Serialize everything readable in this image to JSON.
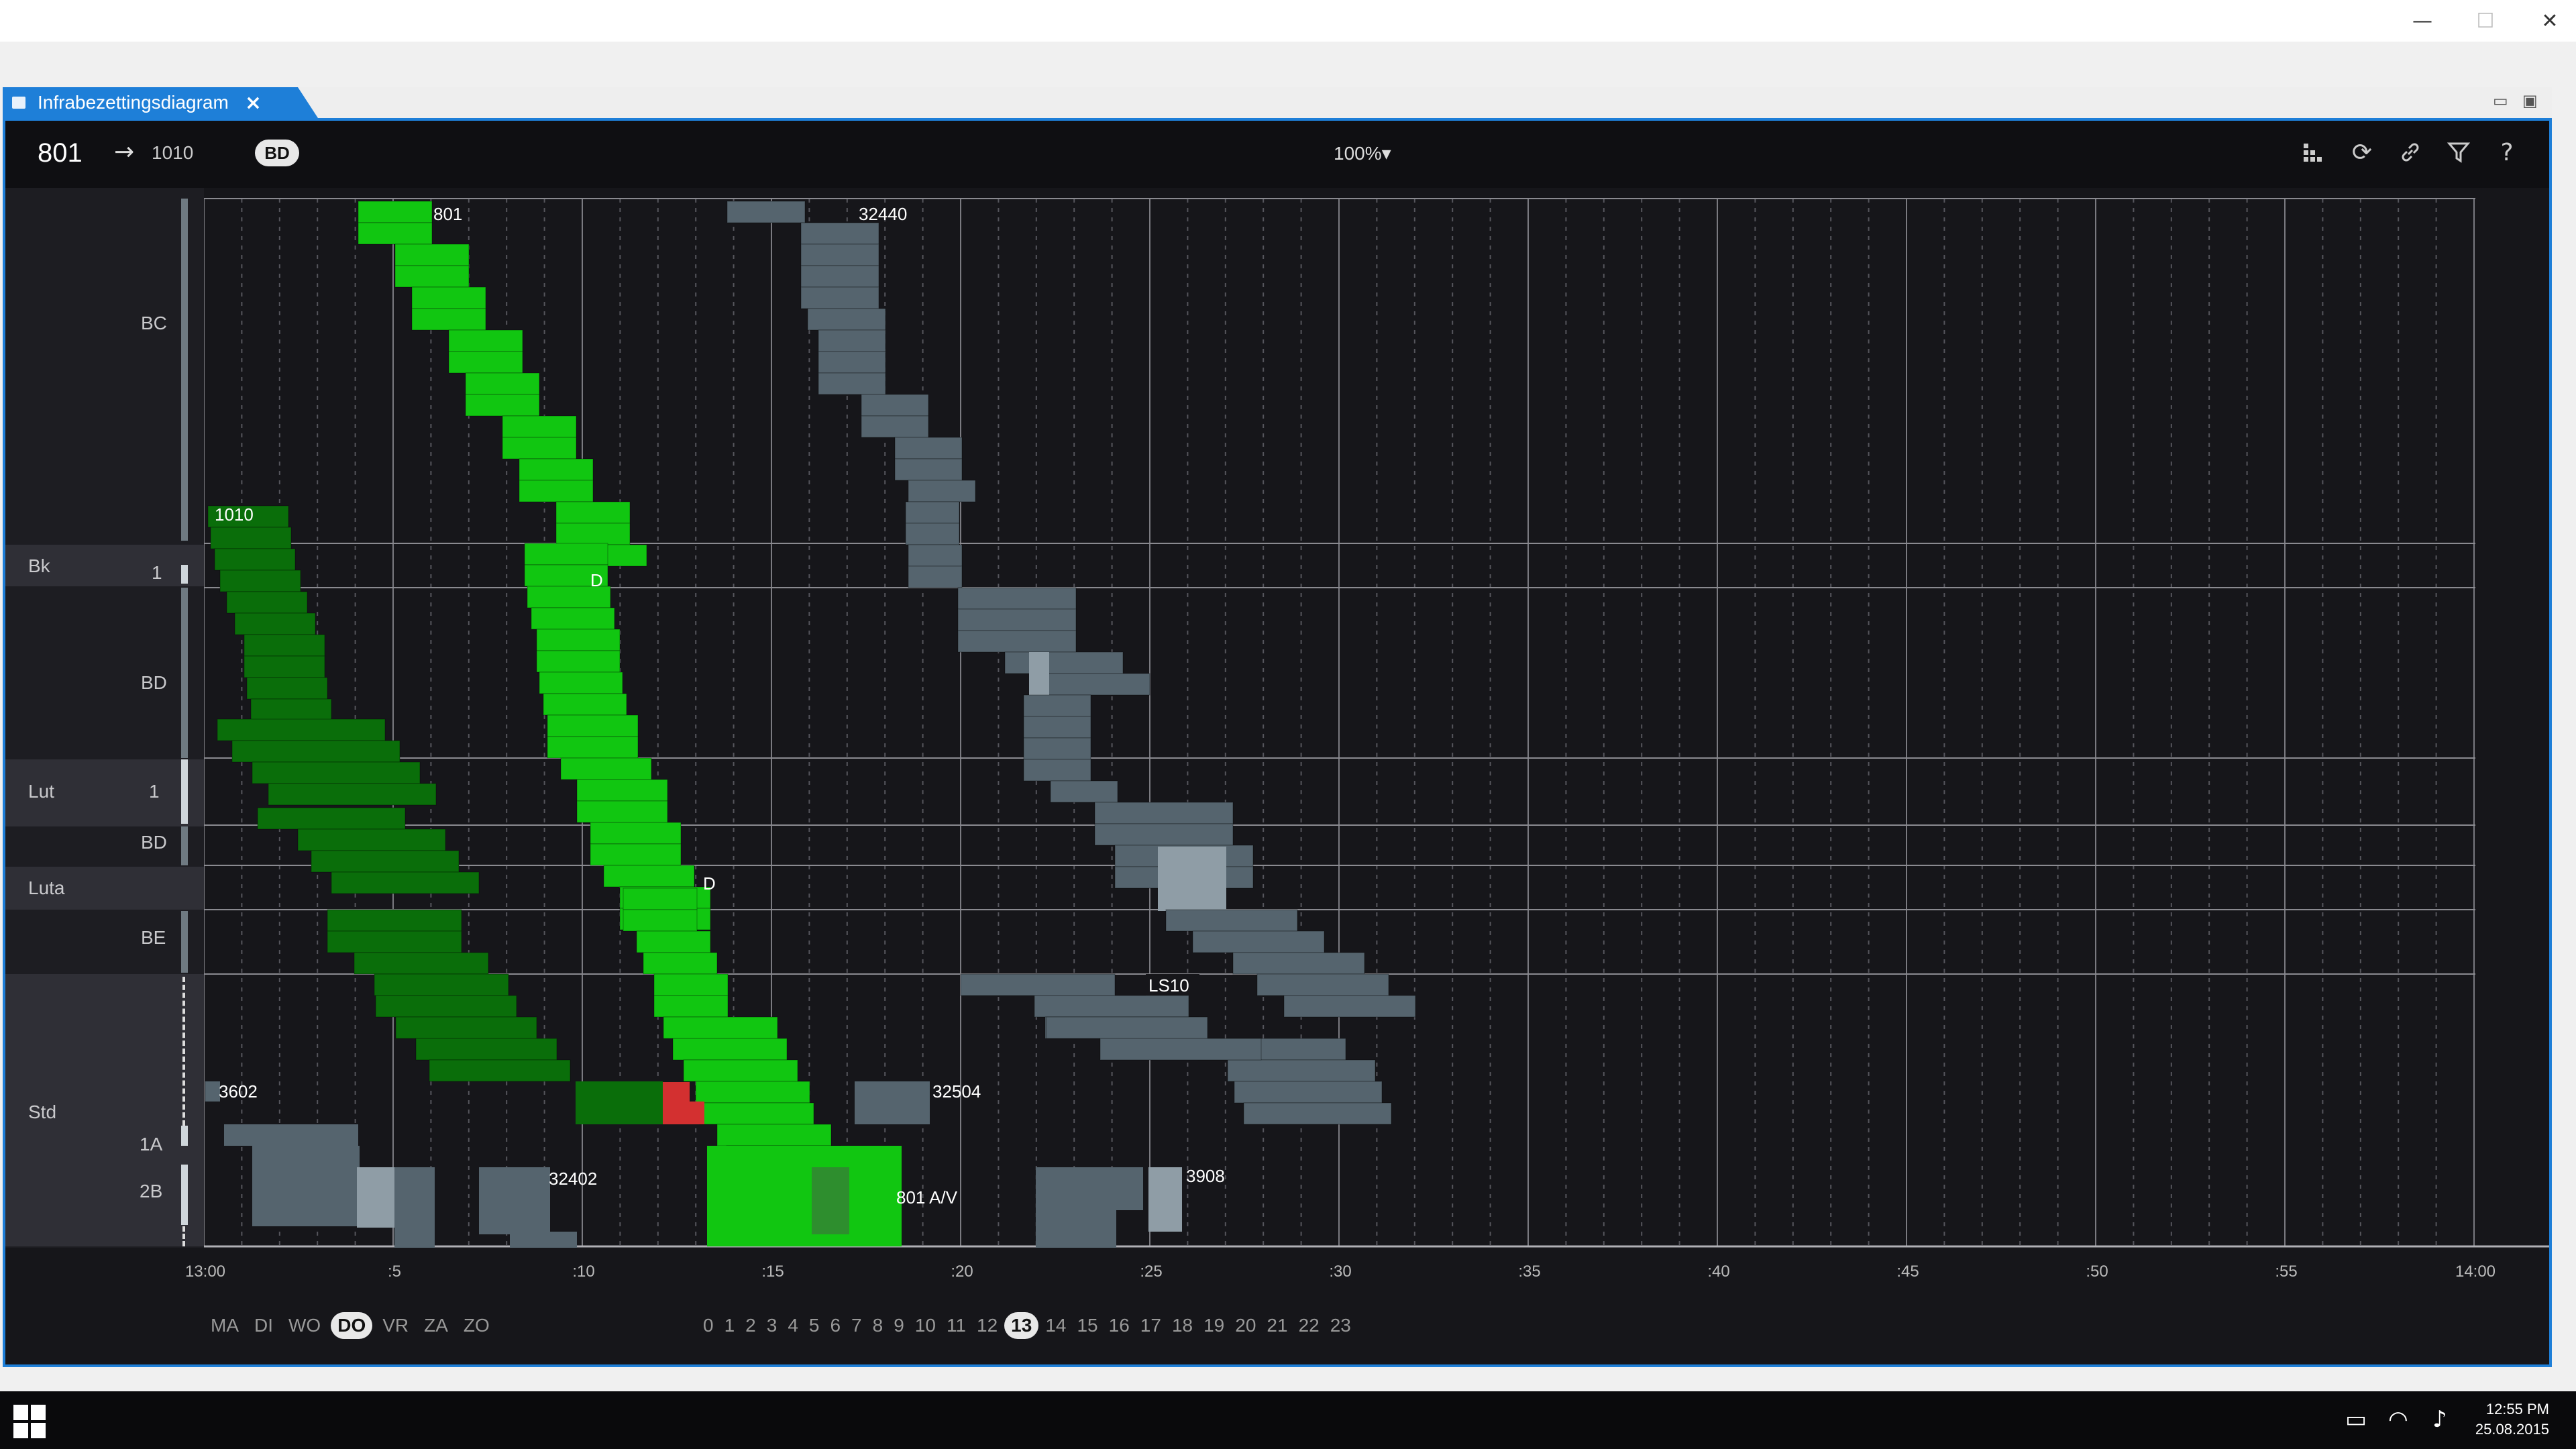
{
  "window": {
    "tab_title": "Infrabezettingsdiagram",
    "tab_close": "×",
    "minimize": "—",
    "maximize": "☐",
    "close": "✕"
  },
  "toolbar": {
    "train": "801",
    "arrow": "→",
    "destination": "1010",
    "badge": "BD",
    "zoom": "100%▾",
    "icons": [
      "layout-icon",
      "refresh-icon",
      "link-icon",
      "filter-icon",
      "help-icon"
    ]
  },
  "sidebar": {
    "labels": {
      "bc": "BC",
      "bk": "Bk",
      "bk_track": "1",
      "bd1": "BD",
      "lut": "Lut",
      "lut_track": "1",
      "bd2": "BD",
      "luta": "Luta",
      "be": "BE",
      "std": "Std",
      "t1a": "1A",
      "t2b": "2B"
    }
  },
  "chart_data": {
    "type": "gantt",
    "time_ticks": [
      "13:00",
      ":5",
      ":10",
      ":15",
      ":20",
      ":25",
      ":30",
      ":35",
      ":40",
      ":45",
      ":50",
      ":55",
      "14:00"
    ],
    "train_labels": {
      "t801": "801",
      "t32440": "32440",
      "t1010": "1010",
      "d1": "D",
      "d2": "D",
      "tLS10": "LS10",
      "t3602": "3602",
      "t32504": "32504",
      "t32402": "32402",
      "t3908": "3908",
      "t801av": "801 A/V"
    },
    "colors": {
      "primary": "#11c611",
      "secondary": "#0a6e0a",
      "other": "#55646e",
      "highlight": "#8f9da6",
      "conflict": "#d33030"
    }
  },
  "day_selector": [
    "MA",
    "DI",
    "WO",
    "DO",
    "VR",
    "ZA",
    "ZO"
  ],
  "day_selected": "DO",
  "hour_selector": [
    "0",
    "1",
    "2",
    "3",
    "4",
    "5",
    "6",
    "7",
    "8",
    "9",
    "10",
    "11",
    "12",
    "13",
    "14",
    "15",
    "16",
    "17",
    "18",
    "19",
    "20",
    "21",
    "22",
    "23"
  ],
  "hour_selected": "13",
  "taskbar": {
    "time": "12:55 PM",
    "date": "25.08.2015"
  }
}
